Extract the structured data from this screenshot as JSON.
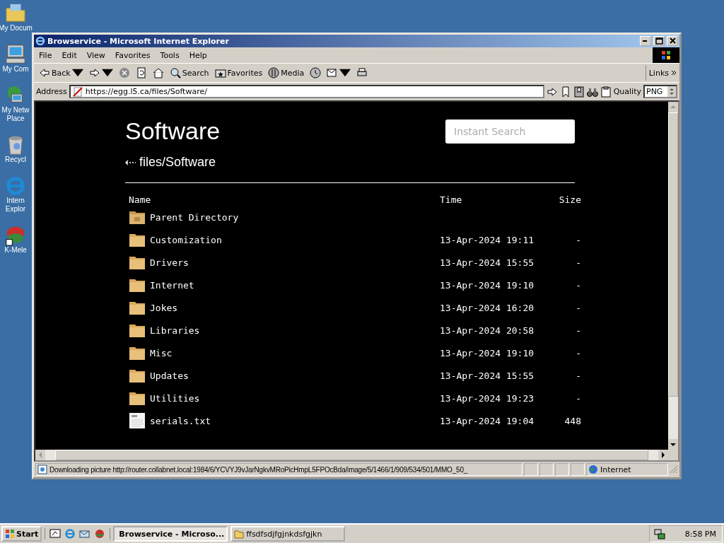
{
  "desktop_icons": [
    {
      "lines": [
        "My Docum"
      ]
    },
    {
      "lines": [
        "My Com"
      ]
    },
    {
      "lines": [
        "My Netw",
        "Place"
      ]
    },
    {
      "lines": [
        "Recycl"
      ]
    },
    {
      "lines": [
        "Intern",
        "Explor"
      ]
    },
    {
      "lines": [
        "K-Mele"
      ]
    }
  ],
  "window": {
    "title": "Browservice - Microsoft Internet Explorer",
    "menu": [
      "File",
      "Edit",
      "View",
      "Favorites",
      "Tools",
      "Help"
    ],
    "toolbar": [
      {
        "label": "Back",
        "dropdown": true
      },
      {
        "dropdown": true
      },
      {
        "dropdown": false
      },
      {
        "dropdown": false
      },
      {
        "dropdown": false
      },
      {
        "label": "Search",
        "dropdown": false
      },
      {
        "label": "Favorites",
        "dropdown": false
      },
      {
        "label": "Media",
        "dropdown": false
      },
      {
        "dropdown": false
      },
      {
        "dropdown": true
      },
      {
        "dropdown": false
      }
    ],
    "links": "Links",
    "address_label": "Address",
    "url": "https://egg.l5.ca/files/Software/",
    "quality_label": "Quality",
    "quality_value": "PNG",
    "status": "Downloading picture http://router.collabnet.local:1984/6/YCVYJ9vJarNgkvMRoPicHmpL5FPOcBda/image/5/1466/1/909/534/501/MMO_50_",
    "zone": "Internet"
  },
  "page": {
    "title": "Software",
    "search": {
      "placeholder": "Instant Search"
    },
    "breadcrumb": "files/Software",
    "columns": [
      "Name",
      "Time",
      "Size"
    ],
    "rows": [
      {
        "kind": "parent",
        "name": "Parent Directory"
      },
      {
        "kind": "folder",
        "name": "Customization",
        "time": "13-Apr-2024 19:11",
        "size": "-"
      },
      {
        "kind": "folder",
        "name": "Drivers",
        "time": "13-Apr-2024 15:55",
        "size": "-"
      },
      {
        "kind": "folder",
        "name": "Internet",
        "time": "13-Apr-2024 19:10",
        "size": "-"
      },
      {
        "kind": "folder",
        "name": "Jokes",
        "time": "13-Apr-2024 16:20",
        "size": "-"
      },
      {
        "kind": "folder",
        "name": "Libraries",
        "time": "13-Apr-2024 20:58",
        "size": "-"
      },
      {
        "kind": "folder",
        "name": "Misc",
        "time": "13-Apr-2024 19:10",
        "size": "-"
      },
      {
        "kind": "folder",
        "name": "Updates",
        "time": "13-Apr-2024 15:55",
        "size": "-"
      },
      {
        "kind": "folder",
        "name": "Utilities",
        "time": "13-Apr-2024 19:23",
        "size": "-"
      },
      {
        "kind": "file",
        "name": "serials.txt",
        "time": "13-Apr-2024 19:04",
        "size": "448"
      }
    ]
  },
  "taskbar": {
    "start": "Start",
    "tasks": [
      {
        "label": "Browservice - Microso...",
        "selected": true
      },
      {
        "label": "ffsdfsdjfgjnkdsfgjkn",
        "selected": false
      }
    ],
    "clock": "8:58 PM"
  }
}
